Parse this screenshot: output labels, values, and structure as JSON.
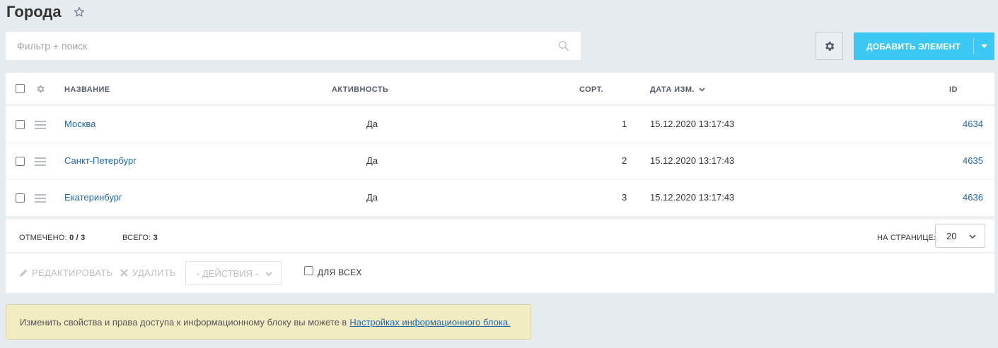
{
  "page": {
    "title": "Города"
  },
  "filter": {
    "placeholder": "Фильтр + поиск"
  },
  "toolbar": {
    "add_label": "ДОБАВИТЬ ЭЛЕМЕНТ"
  },
  "columns": {
    "name": "НАЗВАНИЕ",
    "active": "АКТИВНОСТЬ",
    "sort": "СОРТ.",
    "date": "ДАТА ИЗМ.",
    "id": "ID"
  },
  "rows": [
    {
      "name": "Москва",
      "active": "Да",
      "sort": "1",
      "date": "15.12.2020 13:17:43",
      "id": "4634"
    },
    {
      "name": "Санкт-Петербург",
      "active": "Да",
      "sort": "2",
      "date": "15.12.2020 13:17:43",
      "id": "4635"
    },
    {
      "name": "Екатеринбург",
      "active": "Да",
      "sort": "3",
      "date": "15.12.2020 13:17:43",
      "id": "4636"
    }
  ],
  "footer": {
    "selected_label": "ОТМЕЧЕНО:",
    "selected_value": "0 / 3",
    "total_label": "ВСЕГО:",
    "total_value": "3",
    "per_page_label": "НА СТРАНИЦЕ:",
    "per_page_value": "20"
  },
  "actions": {
    "edit": "РЕДАКТИРОВАТЬ",
    "delete": "УДАЛИТЬ",
    "select_value": "- ДЕЙСТВИЯ -",
    "for_all": "ДЛЯ ВСЕХ"
  },
  "notice": {
    "text": "Изменить свойства и права доступа к информационному блоку вы можете в",
    "link": "Настройках информационного блока."
  },
  "colors": {
    "background": "#e5ebee",
    "accent": "#3bc8f5",
    "link": "#2067b0",
    "notice_bg": "#f1ecc2"
  },
  "icons": [
    "star-icon",
    "search-icon",
    "gear-icon",
    "chevron-down-icon",
    "drag-handle-icon",
    "pencil-icon",
    "cross-icon"
  ]
}
